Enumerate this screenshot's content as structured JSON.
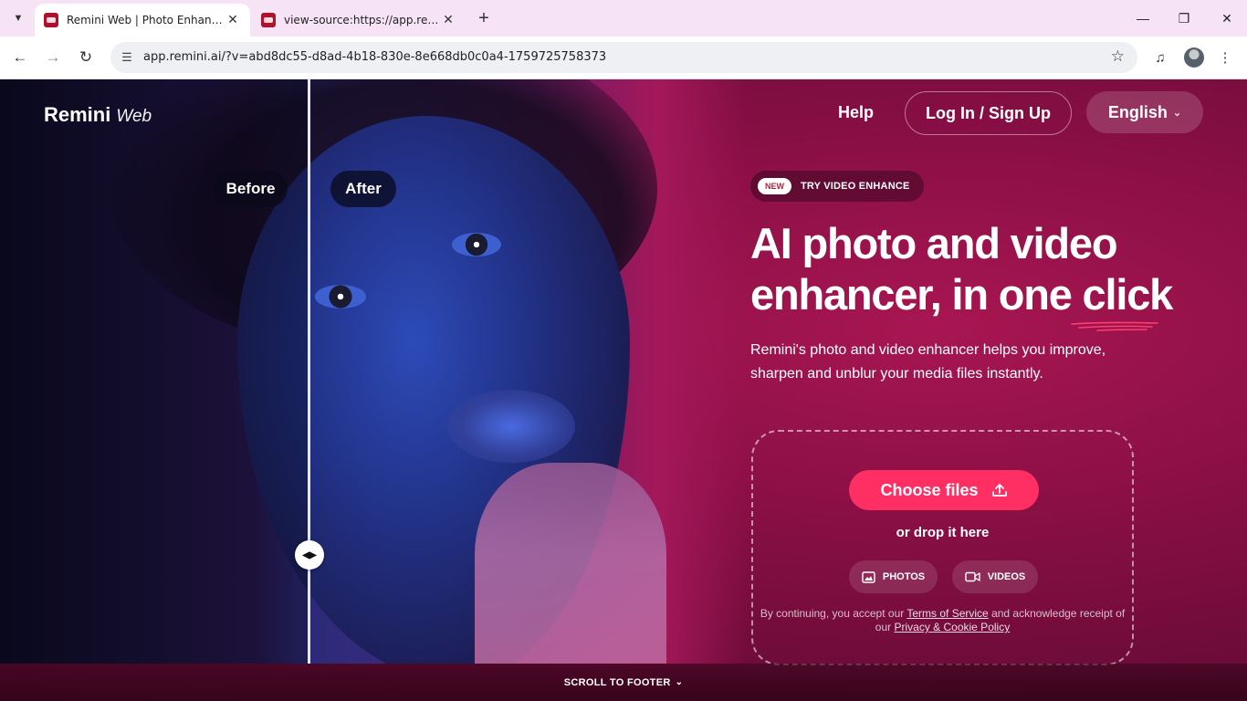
{
  "browser": {
    "tabs": [
      {
        "title": "Remini Web | Photo Enhancer",
        "active": true
      },
      {
        "title": "view-source:https://app.remini.ai",
        "active": false
      }
    ],
    "url": "app.remini.ai/?v=abd8dc55-d8ad-4b18-830e-8e668db0c0a4-1759725758373",
    "icons": {
      "tab_search": "chevron-down-icon",
      "new_tab": "plus-icon",
      "back": "arrow-left-icon",
      "forward": "arrow-right-icon",
      "reload": "reload-icon",
      "site_info": "tune-icon",
      "bookmark": "star-icon",
      "media": "media-queue-icon",
      "menu": "kebab-menu-icon"
    }
  },
  "header": {
    "logo": "Remini",
    "logo_sub": "Web",
    "help": "Help",
    "login": "Log In / Sign Up",
    "language": "English"
  },
  "hero": {
    "before_label": "Before",
    "after_label": "After",
    "promo_badge": "NEW",
    "promo_text": "TRY VIDEO ENHANCE",
    "headline_line1": "AI photo and video",
    "headline_line2": "enhancer, in one click",
    "subtext": "Remini's photo and video enhancer helps you improve, sharpen and unblur your media files instantly."
  },
  "upload": {
    "choose_label": "Choose files",
    "drop_text": "or drop it here",
    "photos_label": "PHOTOS",
    "videos_label": "VIDEOS",
    "legal_prefix": "By continuing, you accept our",
    "terms_link": "Terms of Service",
    "legal_mid": "and acknowledge receipt of our",
    "privacy_link": "Privacy & Cookie Policy"
  },
  "footer": {
    "scroll_label": "SCROLL TO FOOTER"
  },
  "colors": {
    "accent": "#ff2f63",
    "background": "#8a0f45",
    "tabbar": "#f6e4f6"
  }
}
